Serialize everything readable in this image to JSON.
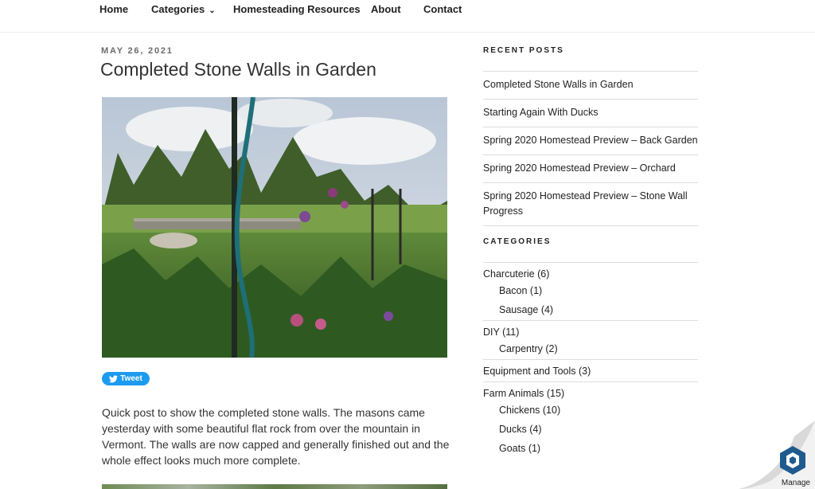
{
  "nav": {
    "items": [
      "Home",
      "Categories",
      "Homesteading Resources",
      "About",
      "Contact"
    ]
  },
  "post": {
    "date": "MAY 26, 2021",
    "title": "Completed Stone Walls in Garden",
    "tweet_label": "Tweet",
    "body": "Quick post to show the completed stone walls. The masons came yesterday with some beautiful flat rock from over the mountain in Vermont. The walls are now capped and generally finished out and the whole effect looks much more complete."
  },
  "sidebar": {
    "recent_title": "RECENT POSTS",
    "recent_posts": [
      "Completed Stone Walls in Garden",
      "Starting Again With Ducks",
      "Spring 2020 Homestead Preview – Back Garden",
      "Spring 2020 Homestead Preview – Orchard",
      "Spring 2020 Homestead Preview – Stone Wall Progress"
    ],
    "categories_title": "CATEGORIES",
    "categories": {
      "charcuterie": "Charcuterie (6)",
      "bacon": "Bacon (1)",
      "sausage": "Sausage (4)",
      "diy": "DIY (11)",
      "carpentry": "Carpentry (2)",
      "equipment": "Equipment and Tools (3)",
      "farm_animals": "Farm Animals (15)",
      "chickens": "Chickens (10)",
      "ducks": "Ducks (4)",
      "goats": "Goats (1)"
    }
  },
  "manage": {
    "label": "Manage"
  },
  "colors": {
    "tweet": "#1d9bf0",
    "manage_icon": "#1f5a8f"
  }
}
